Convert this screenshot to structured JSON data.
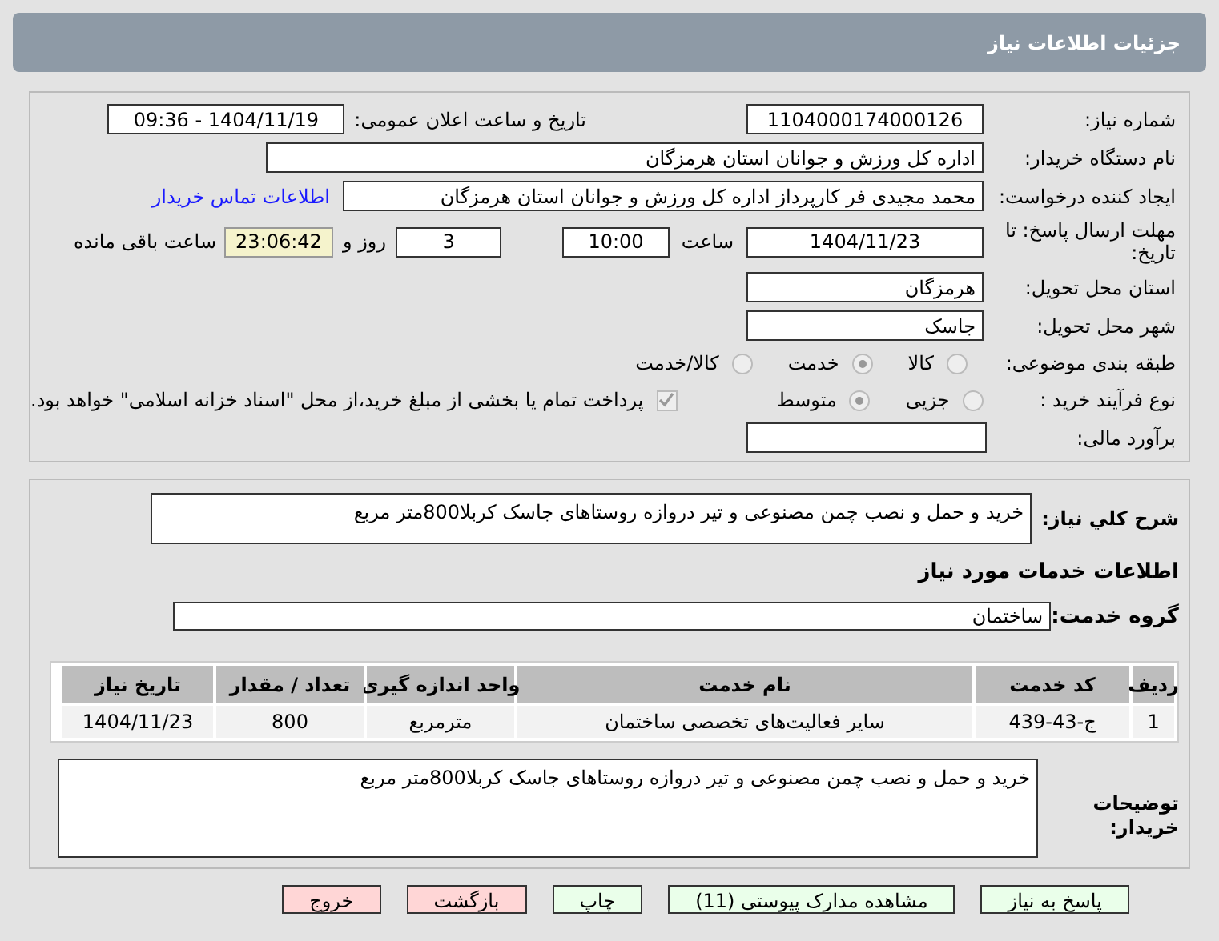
{
  "title": "جزئیات اطلاعات نیاز",
  "need_number": {
    "label": "شماره نیاز:",
    "value": "1104000174000126"
  },
  "announce": {
    "label": "تاریخ و ساعت اعلان عمومی:",
    "value": "1404/11/19 - 09:36"
  },
  "buyer_org": {
    "label": "نام دستگاه خریدار:",
    "value": "اداره کل ورزش و جوانان استان هرمزگان"
  },
  "requester": {
    "label": "ایجاد کننده درخواست:",
    "value": "محمد مجیدی فر کارپرداز اداره کل ورزش و جوانان استان هرمزگان",
    "link": "اطلاعات تماس خریدار"
  },
  "deadline": {
    "label": "مهلت ارسال پاسخ: تا تاریخ:",
    "date": "1404/11/23",
    "time_label": "ساعت",
    "time": "10:00",
    "days": "3",
    "days_label": "روز و",
    "remaining": "23:06:42",
    "remaining_label": "ساعت باقی مانده"
  },
  "province": {
    "label": "استان محل تحویل:",
    "value": "هرمزگان"
  },
  "city": {
    "label": "شهر محل تحویل:",
    "value": "جاسک"
  },
  "category": {
    "label": "طبقه بندی موضوعی:",
    "options": [
      {
        "label": "کالا",
        "selected": false
      },
      {
        "label": "خدمت",
        "selected": true
      },
      {
        "label": "کالا/خدمت",
        "selected": false
      }
    ]
  },
  "process": {
    "label": "نوع فرآیند خرید :",
    "options": [
      {
        "label": "جزیی",
        "selected": false
      },
      {
        "label": "متوسط",
        "selected": true
      }
    ],
    "payment": {
      "checked": true,
      "label": "پرداخت تمام یا بخشی از مبلغ خرید،از محل \"اسناد خزانه اسلامی\" خواهد بود."
    }
  },
  "estimate": {
    "label": "برآورد مالی:"
  },
  "description": {
    "label": "شرح کلي نیاز:",
    "value": "خرید و حمل و نصب چمن مصنوعی و تیر دروازه روستاهای جاسک کربلا800متر مربع"
  },
  "services_heading": "اطلاعات خدمات مورد نیاز",
  "service_group": {
    "label": "گروه خدمت:",
    "value": "ساختمان"
  },
  "table": {
    "columns": [
      "ردیف",
      "کد خدمت",
      "نام خدمت",
      "واحد اندازه گیری",
      "تعداد / مقدار",
      "تاریخ نیاز"
    ],
    "rows": [
      [
        "1",
        "ج-43-439",
        "سایر فعالیت‌های تخصصی ساختمان",
        "مترمربع",
        "800",
        "1404/11/23"
      ]
    ]
  },
  "buyer_notes": {
    "label": "توضیحات خریدار:",
    "value": "خرید و حمل و نصب چمن مصنوعی و تیر دروازه روستاهای جاسک کربلا800متر مربع"
  },
  "buttons": [
    {
      "label": "پاسخ به نیاز",
      "kind": "go"
    },
    {
      "label": "مشاهده مدارک پیوستی (11)",
      "kind": "go"
    },
    {
      "label": "چاپ",
      "kind": "go"
    },
    {
      "label": "بازگشت",
      "kind": "stop"
    },
    {
      "label": "خروج",
      "kind": "stop"
    }
  ]
}
